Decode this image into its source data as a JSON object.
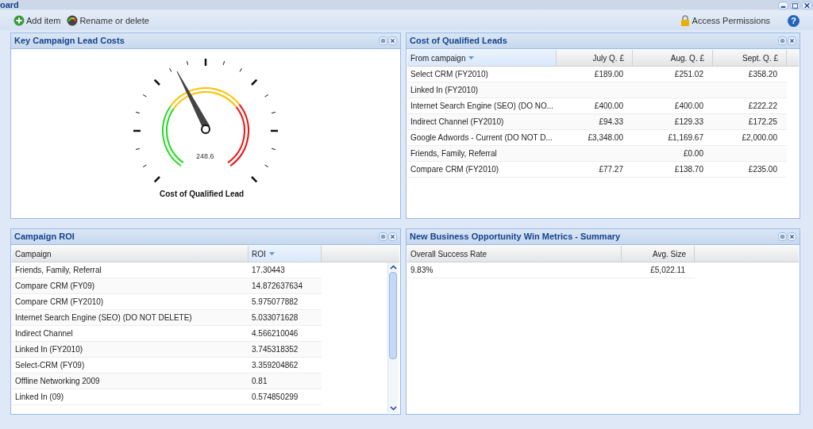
{
  "window": {
    "title": "oard"
  },
  "toolbar": {
    "left": [
      {
        "kind": "add",
        "label": "Add item"
      },
      {
        "kind": "gauge",
        "label": "Rename or delete"
      }
    ],
    "right": [
      {
        "kind": "lock",
        "label": "Access Permissions"
      },
      {
        "kind": "help",
        "label": "?"
      }
    ]
  },
  "panels": [
    {
      "title": "Key Campaign Lead Costs",
      "kind": "gauge",
      "gauge": {
        "value": "248.6",
        "title": "Cost of Qualified Lead"
      }
    },
    {
      "title": "Cost of Qualified Leads",
      "kind": "table",
      "columns": [
        {
          "label": "From campaign",
          "sorted": true
        },
        {
          "label": "July Q. £",
          "sorted": false
        },
        {
          "label": "Aug. Q. £",
          "sorted": false
        },
        {
          "label": "Sept. Q. £",
          "sorted": false
        }
      ],
      "rows": [
        [
          "Select CRM (FY2010)",
          "£189.00",
          "£251.02",
          "£358.20"
        ],
        [
          "Linked In (FY2010)",
          "",
          "",
          ""
        ],
        [
          "Internet Search Engine (SEO) (DO NO...",
          "£400.00",
          "£400.00",
          "£222.22"
        ],
        [
          "Indirect Channel (FY2010)",
          "£94.33",
          "£129.33",
          "£172.25"
        ],
        [
          "Google Adwords - Current (DO NOT D...",
          "£3,348.00",
          "£1,169.67",
          "£2,000.00"
        ],
        [
          "Friends, Family, Referral",
          "",
          "£0.00",
          ""
        ],
        [
          "Compare CRM (FY2010)",
          "£77.27",
          "£138.70",
          "£235.00"
        ]
      ]
    },
    {
      "title": "Campaign ROI",
      "kind": "table",
      "scrollbar": true,
      "columns": [
        {
          "label": "Campaign",
          "sorted": false
        },
        {
          "label": "ROI",
          "sorted": true
        }
      ],
      "rows": [
        [
          "Friends, Family, Referral",
          "17.30443"
        ],
        [
          "Compare CRM (FY09)",
          "14.872637634"
        ],
        [
          "Compare CRM (FY2010)",
          "5.975077882"
        ],
        [
          "Internet Search Engine (SEO) (DO NOT DELETE)",
          "5.033071628"
        ],
        [
          "Indirect Channel",
          "4.566210046"
        ],
        [
          "Linked In (FY2010)",
          "3.745318352"
        ],
        [
          "Select-CRM (FY09)",
          "3.359204862"
        ],
        [
          "Offline Networking 2009",
          "0.81"
        ],
        [
          "Linked In (09)",
          "0.574850299"
        ]
      ]
    },
    {
      "title": "New Business Opportunity Win Metrics - Summary",
      "kind": "table",
      "columns": [
        {
          "label": "Overall Success Rate",
          "sorted": false
        },
        {
          "label": "Avg. Size",
          "sorted": false
        }
      ],
      "rows": [
        [
          "9.83%",
          "£5,022.11"
        ]
      ]
    }
  ]
}
